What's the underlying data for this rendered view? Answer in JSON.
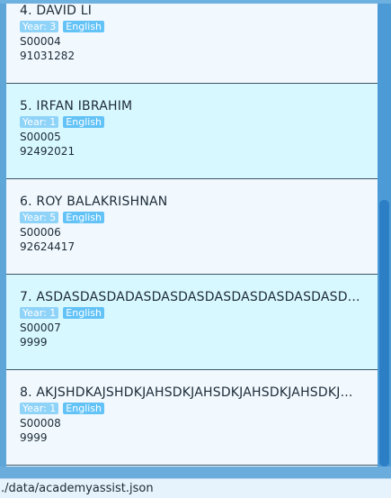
{
  "students": [
    {
      "name": "4. DAVID LI",
      "year": "Year: 3",
      "subject": "English",
      "id": "S00004",
      "phone": "91031282"
    },
    {
      "name": "5. IRFAN IBRAHIM",
      "year": "Year: 1",
      "subject": "English",
      "id": "S00005",
      "phone": "92492021"
    },
    {
      "name": "6. ROY BALAKRISHNAN",
      "year": "Year: 5",
      "subject": "English",
      "id": "S00006",
      "phone": "92624417"
    },
    {
      "name": "7. ASDASDASDADASDASDASDASDASDASDASDASD...",
      "year": "Year: 1",
      "subject": "English",
      "id": "S00007",
      "phone": "9999"
    },
    {
      "name": "8. AKJSHDKAJSHDKJAHSDKJAHSDKJAHSDKJAHSDKJ...",
      "year": "Year: 1",
      "subject": "English",
      "id": "S00008",
      "phone": "9999"
    }
  ],
  "status": {
    "file_path": "./data/academyassist.json"
  },
  "colors": {
    "tag_subject": "#63c3f7",
    "tag_year": "#8fd3f9",
    "card_alt": "#d8f8ff",
    "card": "#f1f9ff"
  }
}
